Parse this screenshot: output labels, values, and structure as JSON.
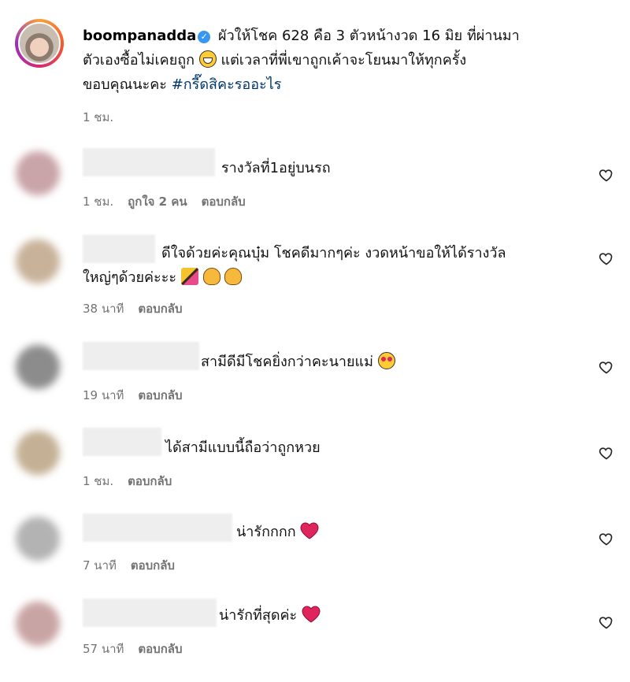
{
  "post": {
    "username": "boompanadda",
    "verified_icon": "verified-badge-icon",
    "caption_line1": "ผัวให้โชค 628 คือ 3 ตัวหน้างวด 16 มิย ที่ผ่านมา",
    "caption_line2_a": "ตัวเองซื้อไม่เคยถูก",
    "caption_line2_b": "แต่เวลาที่พี่เขาถูกเค้าจะโยนมาให้ทุกครั้ง",
    "caption_line3": "ขอบคุณนะคะ",
    "hashtag": "#กรี๊ดสิคะรออะไร",
    "time": "1 ชม."
  },
  "comments": [
    {
      "text": "รางวัลที่1อยู่บนรถ",
      "time": "1 ชม.",
      "likes": "ถูกใจ 2 คน",
      "reply": "ตอบกลับ"
    },
    {
      "text_line1": "ดีใจด้วยค่ะคุณบุ๋ม โชคดีมากๆค่ะ งวดหน้าขอให้ได้รางวัล",
      "text_line2": "ใหญ่ๆด้วยค่ะะะ",
      "time": "38 นาที",
      "reply": "ตอบกลับ"
    },
    {
      "text": "สามีดีมีโชคยิ่งกว่าคะนายแม่",
      "time": "19 นาที",
      "reply": "ตอบกลับ"
    },
    {
      "text": "ได้สามีแบบนี้ถือว่าถูกหวย",
      "time": "1 ชม.",
      "reply": "ตอบกลับ"
    },
    {
      "text": "น่ารักกกก",
      "time": "7 นาที",
      "reply": "ตอบกลับ"
    },
    {
      "text": "น่ารักที่สุดค่ะ",
      "time": "57 นาที",
      "reply": "ตอบกลับ"
    }
  ],
  "colors": {
    "meta": "#737373",
    "hashtag": "#00376b",
    "verified": "#3897f0",
    "heart": "#e0245e"
  }
}
